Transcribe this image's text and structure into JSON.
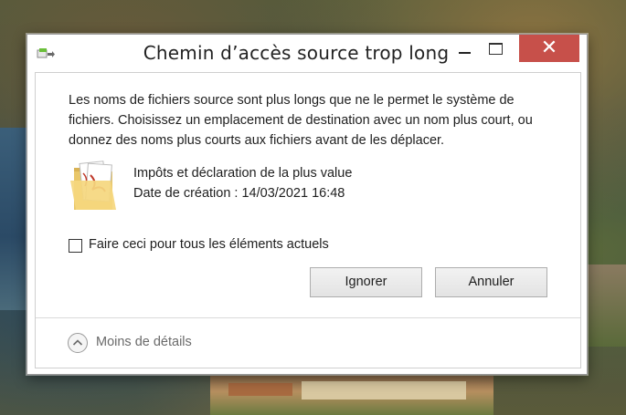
{
  "dialog": {
    "title": "Chemin d’accès source trop long",
    "title_icon": "copy-arrow-icon",
    "window_controls": {
      "minimize_icon": "minimize-icon",
      "maximize_icon": "maximize-icon",
      "close_label": "✕"
    },
    "message": "Les noms de fichiers source sont plus longs que ne le permet le système de fichiers. Choisissez un emplacement de destination avec un nom plus court, ou donnez des noms plus courts aux fichiers avant de les déplacer.",
    "file": {
      "icon": "folder-pdf-icon",
      "name": "Impôts et déclaration de la plus value",
      "date": "Date de création : 14/03/2021 16:48"
    },
    "checkbox": {
      "label": "Faire ceci pour tous les éléments actuels",
      "checked": false
    },
    "buttons": {
      "ignore": "Ignorer",
      "cancel": "Annuler"
    },
    "details_toggle": {
      "label": "Moins de détails",
      "icon": "chevron-up-circle-icon"
    }
  },
  "colors": {
    "close_button": "#c7504a",
    "window_background": "#ffffff",
    "details_text": "#6a6a6a"
  }
}
